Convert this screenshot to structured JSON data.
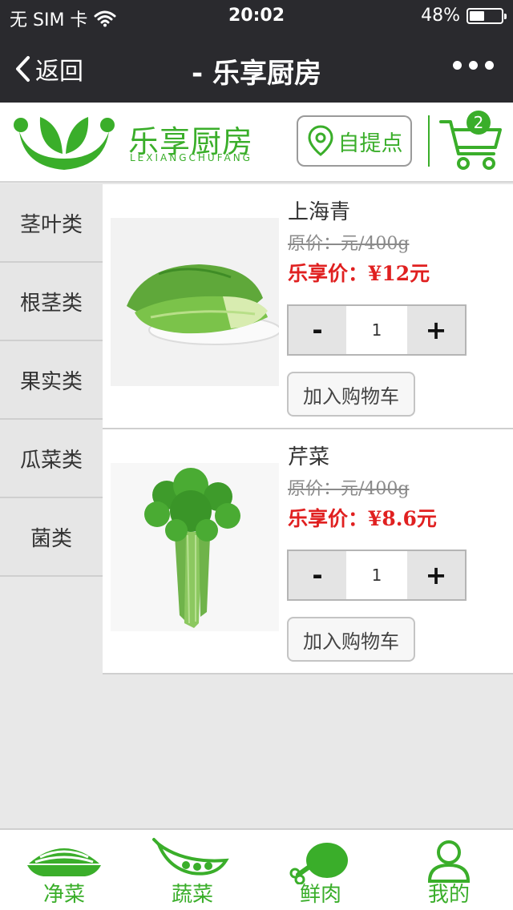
{
  "status_bar": {
    "carrier": "无 SIM 卡",
    "time": "20:02",
    "battery": "48%",
    "battery_level": 0.48
  },
  "nav": {
    "back_label": "返回",
    "title": "- 乐享厨房"
  },
  "header": {
    "logo_cn": "乐享厨房",
    "logo_en": "LEXIANGCHUFANG",
    "pickup_label": "自提点",
    "cart_count": "2",
    "brand_color": "#3aae2a"
  },
  "categories": [
    {
      "label": "茎叶类"
    },
    {
      "label": "根茎类"
    },
    {
      "label": "果实类"
    },
    {
      "label": "瓜菜类"
    },
    {
      "label": "菌类"
    }
  ],
  "products": [
    {
      "name": "上海青",
      "orig_price": "原价：元/400g",
      "price": "乐享价：¥12元",
      "qty": "1",
      "minus": "-",
      "plus": "+",
      "add_to_cart": "加入购物车"
    },
    {
      "name": "芹菜",
      "orig_price": "原价：元/400g",
      "price": "乐享价：¥8.6元",
      "qty": "1",
      "minus": "-",
      "plus": "+",
      "add_to_cart": "加入购物车"
    }
  ],
  "tabs": [
    {
      "label": "净菜",
      "icon": "bowl-icon"
    },
    {
      "label": "蔬菜",
      "icon": "peapod-icon"
    },
    {
      "label": "鲜肉",
      "icon": "drumstick-icon"
    },
    {
      "label": "我的",
      "icon": "user-icon"
    }
  ]
}
